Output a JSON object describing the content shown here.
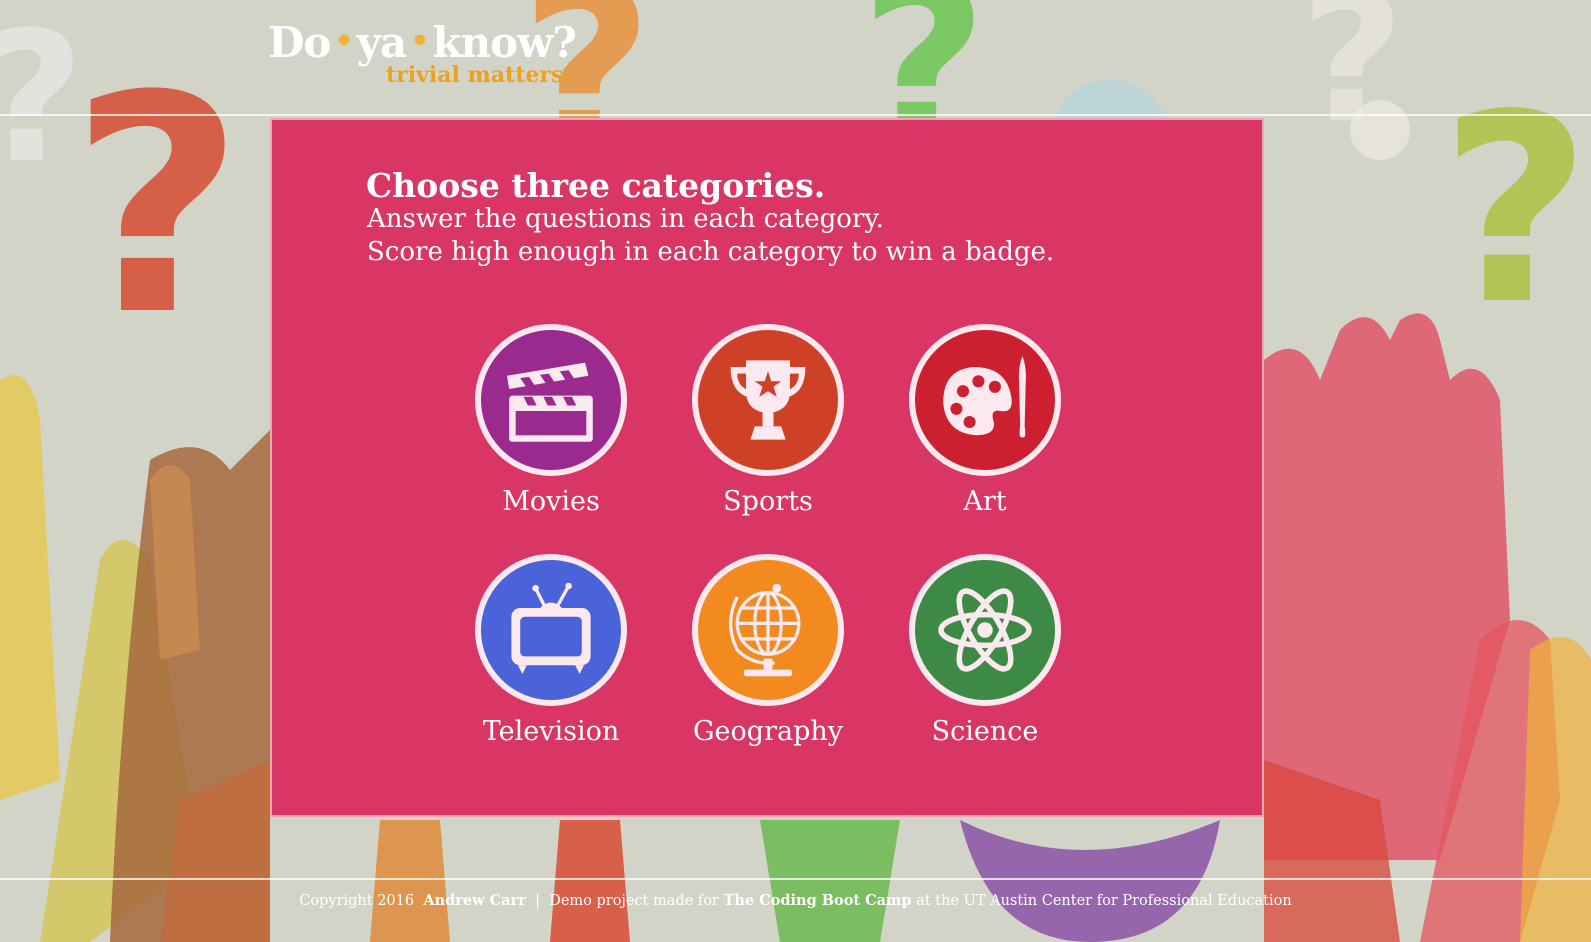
{
  "brand": {
    "word1": "Do",
    "word2": "ya",
    "word3": "know?",
    "dot": "•",
    "tagline": "trivial matters."
  },
  "instructions": {
    "heading": "Choose three categories.",
    "line1": "Answer the questions in each category.",
    "line2": "Score high enough in each category to win a badge."
  },
  "categories": [
    {
      "label": "Movies",
      "icon": "clapperboard-icon",
      "color": "#9b2a8f"
    },
    {
      "label": "Sports",
      "icon": "trophy-icon",
      "color": "#cf4127"
    },
    {
      "label": "Art",
      "icon": "palette-icon",
      "color": "#cc2030"
    },
    {
      "label": "Television",
      "icon": "tv-icon",
      "color": "#4a63d9"
    },
    {
      "label": "Geography",
      "icon": "globe-icon",
      "color": "#f28a20"
    },
    {
      "label": "Science",
      "icon": "atom-icon",
      "color": "#3c8a45"
    }
  ],
  "footer": {
    "copyright": "Copyright 2016",
    "author": "Andrew Carr",
    "separator": "|",
    "demo_text": "Demo project made for",
    "bootcamp": "The Coding Boot Camp",
    "at_text": "at the UT Austin Center for Professional Education"
  },
  "colors": {
    "panel": "#d93565",
    "accent": "#f0a020",
    "badge_border": "#fbe9ef"
  }
}
